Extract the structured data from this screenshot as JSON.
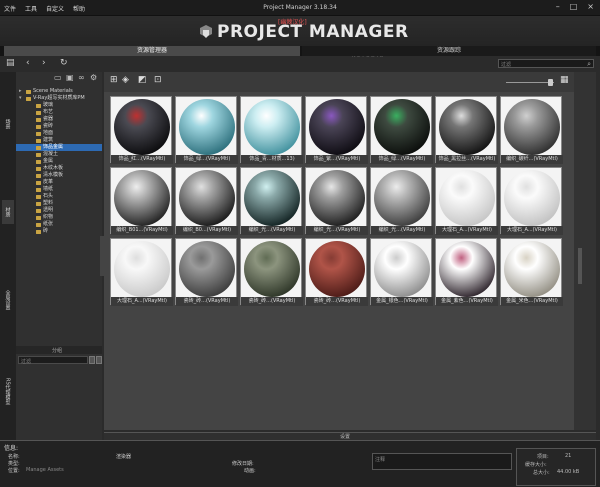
{
  "window": {
    "title": "Project Manager 3.18.34",
    "menu": [
      "文件",
      "工具",
      "自定义",
      "帮助"
    ],
    "badge": "[幽棘汉化]",
    "logo": "PROJECT MANAGER",
    "logo_sub": "KSTUDIO"
  },
  "tabs": [
    "资源管理器",
    "资源跟踪"
  ],
  "search": {
    "placeholder": "过滤"
  },
  "vtabs": [
    "场景",
    "材质",
    "全局设置",
    "RS代理模型"
  ],
  "tree": {
    "roots": [
      "Scene Materials",
      "V-Ray超写实材质库PM"
    ],
    "children": [
      "玻璃",
      "布艺",
      "瓷器",
      "瓷砖",
      "地面",
      "建筑",
      "饰品金属",
      "混凝土",
      "金属",
      "木纹木板",
      "清水模板",
      "皮革",
      "墙纸",
      "石头",
      "塑料",
      "透明",
      "织物",
      "纸张",
      "砖"
    ],
    "selected_index": 6,
    "divider": "分组",
    "filter_placeholder": "过滤"
  },
  "materials": [
    {
      "name": "饰品_红...(VRayMtl)",
      "c1": "#4a4a52",
      "c2": "#0a0a0c",
      "accent": "#c03030"
    },
    {
      "name": "饰品_绿...(VRayMtl)",
      "c1": "#9fd6e0",
      "c2": "#2a6d7a",
      "accent": "#ffffff"
    },
    {
      "name": "饰品_青...材质...13)",
      "c1": "#cdeef2",
      "c2": "#3e8f9c",
      "accent": "#ffffff"
    },
    {
      "name": "饰品_紫...(VRayMtl)",
      "c1": "#4a4456",
      "c2": "#0c0a10",
      "accent": "#8a58c0"
    },
    {
      "name": "饰品_绿...(VRayMtl)",
      "c1": "#3e4a40",
      "c2": "#0a0c0a",
      "accent": "#3ab060"
    },
    {
      "name": "饰品_黑拉丝...(VRayMtl)",
      "c1": "#767676",
      "c2": "#101010",
      "accent": "#dddddd"
    },
    {
      "name": "编织_碳纤...(VRayMtl)",
      "c1": "#9a9a9a",
      "c2": "#2c2c2c",
      "accent": "#cfcfcf"
    },
    {
      "name": "编织_B01...(VRayMtl)",
      "c1": "#b4b4b4",
      "c2": "#1e1e1e",
      "accent": "#eeeeee"
    },
    {
      "name": "编织_B0...(VRayMtl)",
      "c1": "#a4a4a4",
      "c2": "#161616",
      "accent": "#e0e0e0"
    },
    {
      "name": "编织_光...(VRayMtl)",
      "c1": "#8aa8a8",
      "c2": "#102020",
      "accent": "#d0f0f0"
    },
    {
      "name": "编织_光...(VRayMtl)",
      "c1": "#9e9e9e",
      "c2": "#1a1a1a",
      "accent": "#e6e6e6"
    },
    {
      "name": "编织_光...(VRayMtl)",
      "c1": "#b8b8b8",
      "c2": "#3a3a3a",
      "accent": "#ececec"
    },
    {
      "name": "大理石_A...(VRayMtl)",
      "c1": "#fbfbfb",
      "c2": "#c4c4c4",
      "accent": "#e0e0e0"
    },
    {
      "name": "大理石_A...(VRayMtl)",
      "c1": "#fbfbfb",
      "c2": "#c0c0c0",
      "accent": "#e0e0e0"
    },
    {
      "name": "大理石_A...(VRayMtl)",
      "c1": "#f8f8f8",
      "c2": "#c8c8c8",
      "accent": "#dedede"
    },
    {
      "name": "瓷砖_砖...(VRayMtl)",
      "c1": "#9a9a9a",
      "c2": "#3a3a3a",
      "accent": "#707070"
    },
    {
      "name": "瓷砖_砖...(VRayMtl)",
      "c1": "#8c947e",
      "c2": "#2c3426",
      "accent": "#606c54"
    },
    {
      "name": "瓷砖_砖...(VRayMtl)",
      "c1": "#b05448",
      "c2": "#4a1a16",
      "accent": "#863c34"
    },
    {
      "name": "金属_银色...(VRayMtl)",
      "c1": "#ffffff",
      "c2": "#8a8a8a",
      "accent": "#cccccc"
    },
    {
      "name": "金属_紫色...(VRayMtl)",
      "c1": "#ffffff",
      "c2": "#2a2028",
      "accent": "#c06080"
    },
    {
      "name": "金属_米色...(VRayMtl)",
      "c1": "#ffffff",
      "c2": "#908c80",
      "accent": "#d8d2c4"
    }
  ],
  "settings_label": "设置",
  "info": {
    "title": "信息:",
    "name_label": "名称:",
    "name_value": "渲染器",
    "type_label": "类型:",
    "path_label": "位置:",
    "path_value": "Manage Assets",
    "date_label": "修改日期:",
    "size_label": "动画:",
    "notes_placeholder": "注释",
    "count_label": "项目:",
    "count_value": "21",
    "sel_label": "缓存大小:",
    "total_label": "总大小:",
    "total_value": "44.00 kB"
  }
}
